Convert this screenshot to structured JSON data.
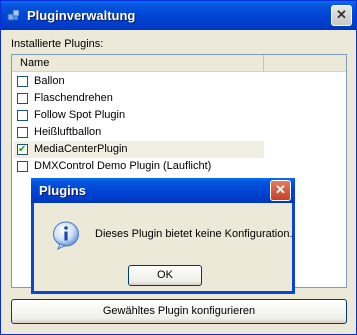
{
  "window": {
    "title": "Pluginverwaltung",
    "close_label": "✕"
  },
  "plugins_label": "Installierte Plugins:",
  "list": {
    "column_header": "Name",
    "items": [
      {
        "label": "Ballon",
        "checked": false
      },
      {
        "label": "Flaschendrehen",
        "checked": false
      },
      {
        "label": "Follow Spot Plugin",
        "checked": false
      },
      {
        "label": "Heißluftballon",
        "checked": false
      },
      {
        "label": "MediaCenterPlugin",
        "checked": true
      },
      {
        "label": "DMXControl Demo Plugin (Lauflicht)",
        "checked": false
      }
    ]
  },
  "configure_button": "Gewähltes Plugin konfigurieren",
  "dialog": {
    "title": "Plugins",
    "close_label": "✕",
    "message": "Dieses Plugin bietet keine Konfiguration.",
    "ok_label": "OK",
    "icon": "info-icon"
  }
}
